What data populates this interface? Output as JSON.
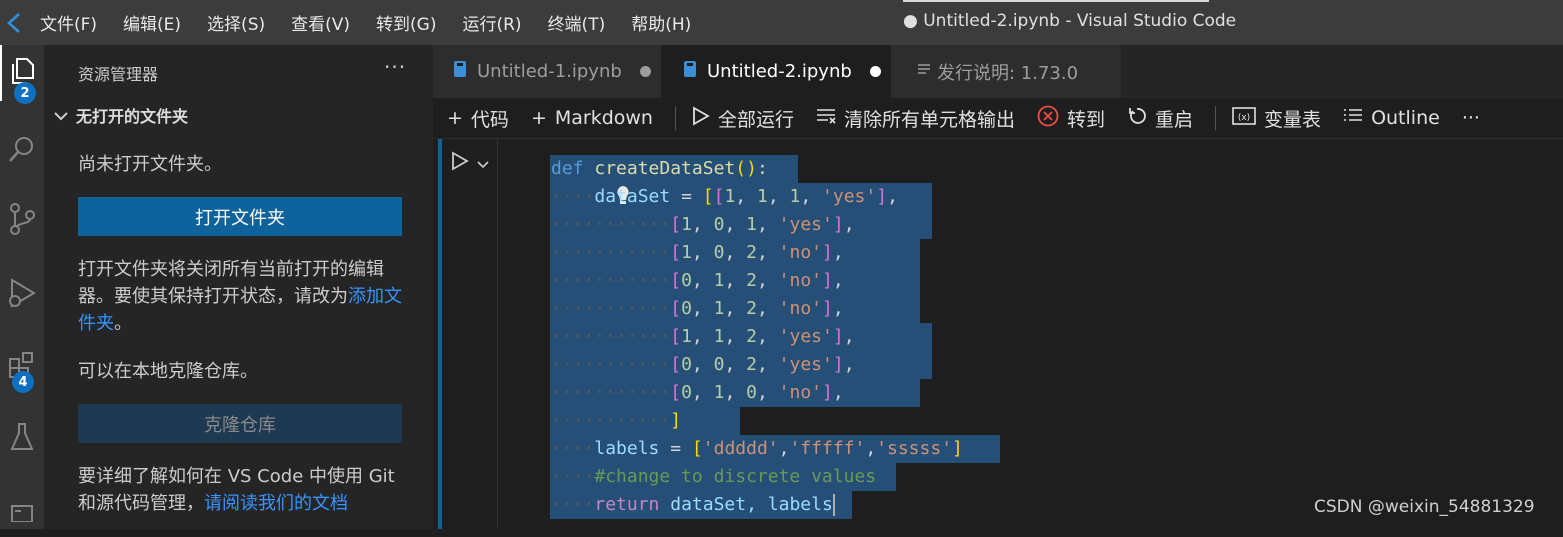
{
  "titlebar": {
    "menu": [
      "文件(F)",
      "编辑(E)",
      "选择(S)",
      "查看(V)",
      "转到(G)",
      "运行(R)",
      "终端(T)",
      "帮助(H)"
    ],
    "title": "● Untitled-2.ipynb - Visual Studio Code"
  },
  "activity_bar": {
    "explorer_badge": "2",
    "extensions_badge": "4"
  },
  "sidebar": {
    "header": "资源管理器",
    "more": "···",
    "section_title": "无打开的文件夹",
    "no_folder_text": "尚未打开文件夹。",
    "open_folder_button": "打开文件夹",
    "info_text_1": "打开文件夹将关闭所有当前打开的编辑器。要使其保持打开状态，请改为",
    "add_folder_link": "添加文件夹",
    "info_text_1_end": "。",
    "clone_text": "可以在本地克隆仓库。",
    "clone_button": "克隆仓库",
    "git_text": "要详细了解如何在 VS Code 中使用 Git 和源代码管理，",
    "git_link": "请阅读我们的文档"
  },
  "tabs": [
    {
      "label": "Untitled-1.ipynb",
      "active": false,
      "dirty": true
    },
    {
      "label": "Untitled-2.ipynb",
      "active": true,
      "dirty": true
    },
    {
      "label": "发行说明: 1.73.0",
      "active": false,
      "dirty": false
    }
  ],
  "notebook_toolbar": {
    "add_code": "代码",
    "add_markdown": "Markdown",
    "run_all": "全部运行",
    "clear_outputs": "清除所有单元格输出",
    "goto": "转到",
    "restart": "重启",
    "variables": "变量表",
    "outline": "Outline",
    "more": "···"
  },
  "code": {
    "def": "def",
    "func": "createDataSet",
    "dataset_var": "dataSet",
    "rows": [
      [
        "1",
        "1",
        "1",
        "'yes'"
      ],
      [
        "1",
        "0",
        "1",
        "'yes'"
      ],
      [
        "1",
        "0",
        "2",
        "'no'"
      ],
      [
        "0",
        "1",
        "2",
        "'no'"
      ],
      [
        "0",
        "1",
        "2",
        "'no'"
      ],
      [
        "1",
        "1",
        "2",
        "'yes'"
      ],
      [
        "0",
        "0",
        "2",
        "'yes'"
      ],
      [
        "0",
        "1",
        "0",
        "'no'"
      ]
    ],
    "labels_var": "labels",
    "labels_values": [
      "'ddddd'",
      "'fffff'",
      "'sssss'"
    ],
    "comment": "#change to discrete values",
    "return_kw": "return",
    "return_values": "dataSet, labels"
  },
  "colors": {
    "accent": "#0e639c",
    "selection": "#264f78",
    "badge": "#0e70c0",
    "link": "#3794ff"
  },
  "watermark": "CSDN @weixin_54881329"
}
